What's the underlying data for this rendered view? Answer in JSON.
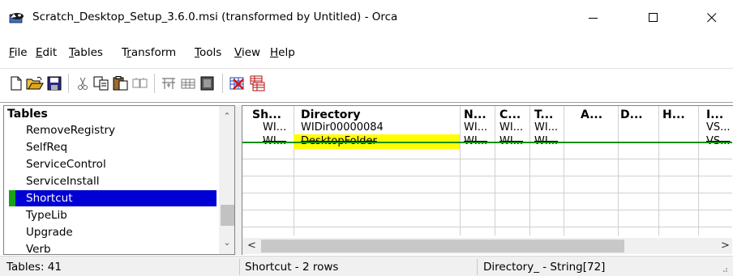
{
  "window": {
    "title": "Scratch_Desktop_Setup_3.6.0.msi (transformed by Untitled) - Orca",
    "minimize_icon": "minimize-icon",
    "maximize_icon": "maximize-icon",
    "close_icon": "close-icon"
  },
  "menu": {
    "items": [
      {
        "label": "File",
        "underline": "F"
      },
      {
        "label": "Edit",
        "underline": "E"
      },
      {
        "label": "Tables",
        "underline": "T"
      },
      {
        "label": "Transform",
        "underline": "r"
      },
      {
        "label": "Tools",
        "underline": "T"
      },
      {
        "label": "View",
        "underline": "V"
      },
      {
        "label": "Help",
        "underline": "H"
      }
    ]
  },
  "toolbar": {
    "icons": [
      "new-icon",
      "open-icon",
      "save-icon",
      "cut-icon",
      "copy-icon",
      "paste-icon",
      "find-icon",
      "add-table-icon",
      "add-row-icon",
      "validate-icon",
      "drop-table-icon",
      "merge-icon"
    ]
  },
  "tables_pane": {
    "header": "Tables",
    "items": [
      "RemoveRegistry",
      "SelfReq",
      "ServiceControl",
      "ServiceInstall",
      "Shortcut",
      "TypeLib",
      "Upgrade",
      "Verb"
    ],
    "selected": "Shortcut"
  },
  "grid": {
    "columns": [
      "Sh...",
      "Directory",
      "N...",
      "C...",
      "T...",
      "A...",
      "D...",
      "H...",
      "I..."
    ],
    "rows": [
      {
        "cells": [
          "WI...",
          "WIDir00000084",
          "WI...",
          "WI...",
          "WI...",
          "",
          "",
          "",
          "VS..."
        ],
        "state": "normal"
      },
      {
        "cells": [
          "WI...",
          "DesktopFolder",
          "WI...",
          "WI...",
          "WI...",
          "",
          "",
          "",
          "VS..."
        ],
        "state": "deleted"
      }
    ]
  },
  "statusbar": {
    "tables_count": "Tables: 41",
    "rows_info": "Shortcut - 2 rows",
    "column_info": "Directory_ - String[72]"
  },
  "colors": {
    "selection": "#0000d4",
    "change_marker": "#17a317",
    "highlight": "#ffff00"
  }
}
